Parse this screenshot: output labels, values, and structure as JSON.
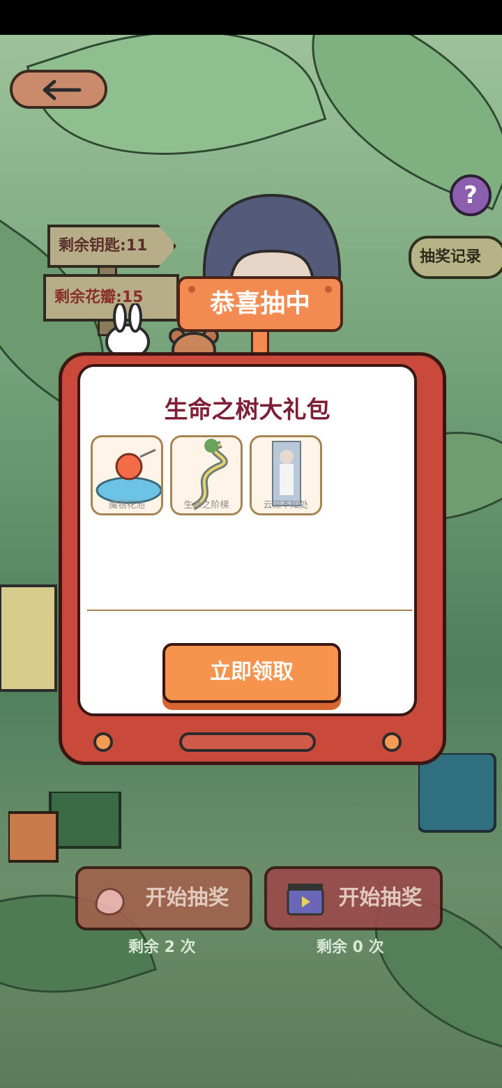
{
  "navigation": {
    "back_icon": "arrow-left-icon",
    "help_label": "?",
    "record_label": "抽奖记录"
  },
  "signs": {
    "keys": "剩余钥匙:11",
    "petals": "剩余花瓣:15"
  },
  "banner": {
    "label": "恭喜抽中"
  },
  "prize": {
    "title": "生命之树大礼包",
    "items": [
      {
        "label": "魔毯花池"
      },
      {
        "label": "生命之阶梯"
      },
      {
        "label": "云深不知处"
      }
    ],
    "claim_label": "立即领取"
  },
  "actions": {
    "draw_petal_label": "开始抽奖",
    "draw_video_label": "开始抽奖",
    "remaining_petal": "剩余 2 次",
    "remaining_video": "剩余 0 次"
  }
}
